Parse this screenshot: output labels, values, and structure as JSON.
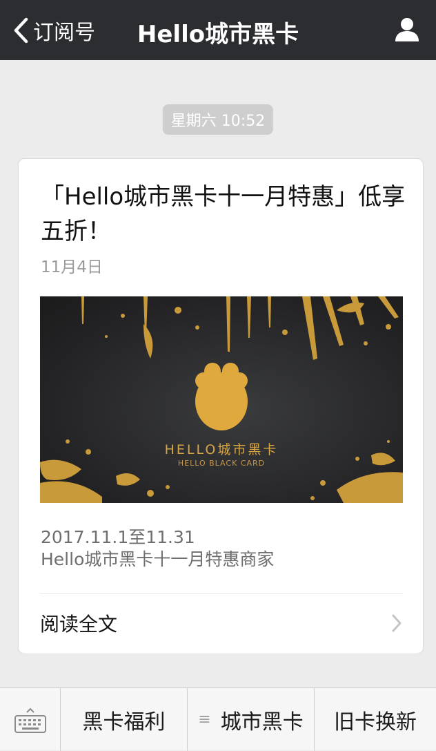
{
  "navbar": {
    "back_label": "订阅号",
    "title": "Hello城市黑卡",
    "icons": {
      "back": "chevron-left-icon",
      "profile": "person-icon"
    }
  },
  "timestamp": "星期六 10:52",
  "article": {
    "title": "「Hello城市黑卡十一月特惠」低享五折！",
    "date": "11月4日",
    "cover": {
      "brand_text": "HELLO城市黑卡",
      "sub_text": "HELLO BLACK CARD"
    },
    "description_line1": "2017.11.1至11.31",
    "description_line2": "Hello城市黑卡十一月特惠商家",
    "read_more": "阅读全文"
  },
  "bottom_menu": {
    "keyboard_icon": "keyboard-icon",
    "items": [
      {
        "label": "黑卡福利"
      },
      {
        "label": "城市黑卡",
        "has_submenu": true
      },
      {
        "label": "旧卡换新"
      }
    ]
  },
  "colors": {
    "navbar_bg": "#2c2d31",
    "page_bg": "#ececec",
    "gold": "#d9a646"
  }
}
